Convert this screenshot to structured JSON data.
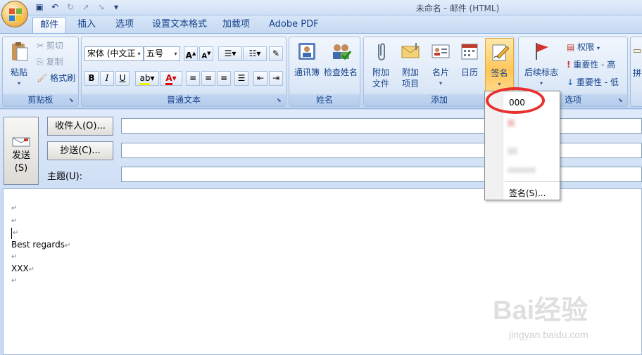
{
  "window": {
    "title": "未命名 - 邮件 (HTML)"
  },
  "tabs": [
    {
      "label": "邮件"
    },
    {
      "label": "插入"
    },
    {
      "label": "选项"
    },
    {
      "label": "设置文本格式"
    },
    {
      "label": "加载项"
    },
    {
      "label": "Adobe PDF"
    }
  ],
  "clipboard": {
    "paste": "粘贴",
    "cut": "剪切",
    "copy": "复制",
    "format_painter": "格式刷",
    "group": "剪贴板"
  },
  "font": {
    "name": "宋体 (中文正",
    "size": "五号",
    "group": "普通文本"
  },
  "names": {
    "address_book": "通讯簿",
    "check_names": "检查姓名",
    "group": "姓名"
  },
  "include": {
    "attach_file_1": "附加",
    "attach_file_2": "文件",
    "attach_item_1": "附加",
    "attach_item_2": "项目",
    "business_card": "名片",
    "calendar": "日历",
    "signature": "签名",
    "group": "添加"
  },
  "options": {
    "follow_up": "后续标志",
    "permission": "权限",
    "high_importance": "重要性 - 高",
    "low_importance": "重要性 - 低",
    "group": "选项",
    "extra": "拼"
  },
  "header": {
    "send_line1": "发送",
    "send_line2": "(S)",
    "to": "收件人(O)...",
    "cc": "抄送(C)...",
    "subject": "主题(U):"
  },
  "body": {
    "line1": "Best regards",
    "line2": "XXX",
    "para_mark": "↵"
  },
  "signature_menu": {
    "item1": "000",
    "more": "签名(S)..."
  },
  "watermark": {
    "brand": "Bai经验",
    "url": "jingyan.baidu.com"
  },
  "colors": {
    "accent": "#15428b",
    "ribbon_bg": "#d3e2f6",
    "highlight": "#e8302f"
  }
}
